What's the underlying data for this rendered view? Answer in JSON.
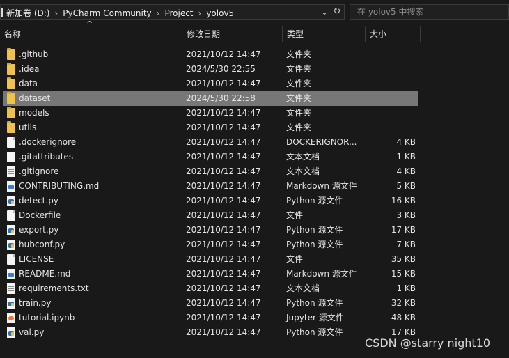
{
  "address_bar": {
    "crumbs": [
      "新加卷 (D:)",
      "PyCharm Community",
      "Project",
      "yolov5"
    ],
    "separator": "›",
    "dropdown_glyph": "⌄",
    "refresh_glyph": "↻"
  },
  "search": {
    "placeholder": "在 yolov5 中搜索"
  },
  "columns": {
    "name": "名称",
    "date": "修改日期",
    "type": "类型",
    "size": "大小",
    "sort_glyph": "^"
  },
  "files": [
    {
      "name": ".github",
      "date": "2021/10/12 14:47",
      "type": "文件夹",
      "size": "",
      "icon": "folder-icon"
    },
    {
      "name": ".idea",
      "date": "2024/5/30 22:55",
      "type": "文件夹",
      "size": "",
      "icon": "folder-icon"
    },
    {
      "name": "data",
      "date": "2021/10/12 14:47",
      "type": "文件夹",
      "size": "",
      "icon": "folder-icon"
    },
    {
      "name": "dataset",
      "date": "2024/5/30 22:58",
      "type": "文件夹",
      "size": "",
      "icon": "folder-icon",
      "selected": true
    },
    {
      "name": "models",
      "date": "2021/10/12 14:47",
      "type": "文件夹",
      "size": "",
      "icon": "folder-icon"
    },
    {
      "name": "utils",
      "date": "2021/10/12 14:47",
      "type": "文件夹",
      "size": "",
      "icon": "folder-icon"
    },
    {
      "name": ".dockerignore",
      "date": "2021/10/12 14:47",
      "type": "DOCKERIGNOR...",
      "size": "4 KB",
      "icon": "file-icon"
    },
    {
      "name": ".gitattributes",
      "date": "2021/10/12 14:47",
      "type": "文本文档",
      "size": "1 KB",
      "icon": "text-file-icon"
    },
    {
      "name": ".gitignore",
      "date": "2021/10/12 14:47",
      "type": "文本文档",
      "size": "4 KB",
      "icon": "text-file-icon"
    },
    {
      "name": "CONTRIBUTING.md",
      "date": "2021/10/12 14:47",
      "type": "Markdown 源文件",
      "size": "5 KB",
      "icon": "markdown-file-icon"
    },
    {
      "name": "detect.py",
      "date": "2021/10/12 14:47",
      "type": "Python 源文件",
      "size": "16 KB",
      "icon": "python-file-icon"
    },
    {
      "name": "Dockerfile",
      "date": "2021/10/12 14:47",
      "type": "文件",
      "size": "3 KB",
      "icon": "file-icon"
    },
    {
      "name": "export.py",
      "date": "2021/10/12 14:47",
      "type": "Python 源文件",
      "size": "17 KB",
      "icon": "python-file-icon"
    },
    {
      "name": "hubconf.py",
      "date": "2021/10/12 14:47",
      "type": "Python 源文件",
      "size": "7 KB",
      "icon": "python-file-icon"
    },
    {
      "name": "LICENSE",
      "date": "2021/10/12 14:47",
      "type": "文件",
      "size": "35 KB",
      "icon": "file-icon"
    },
    {
      "name": "README.md",
      "date": "2021/10/12 14:47",
      "type": "Markdown 源文件",
      "size": "15 KB",
      "icon": "markdown-file-icon"
    },
    {
      "name": "requirements.txt",
      "date": "2021/10/12 14:47",
      "type": "文本文档",
      "size": "1 KB",
      "icon": "text-file-icon"
    },
    {
      "name": "train.py",
      "date": "2021/10/12 14:47",
      "type": "Python 源文件",
      "size": "32 KB",
      "icon": "python-file-icon"
    },
    {
      "name": "tutorial.ipynb",
      "date": "2021/10/12 14:47",
      "type": "Jupyter 源文件",
      "size": "48 KB",
      "icon": "notebook-file-icon"
    },
    {
      "name": "val.py",
      "date": "2021/10/12 14:47",
      "type": "Python 源文件",
      "size": "17 KB",
      "icon": "python-file-icon"
    }
  ],
  "watermark": "CSDN @starry night10"
}
